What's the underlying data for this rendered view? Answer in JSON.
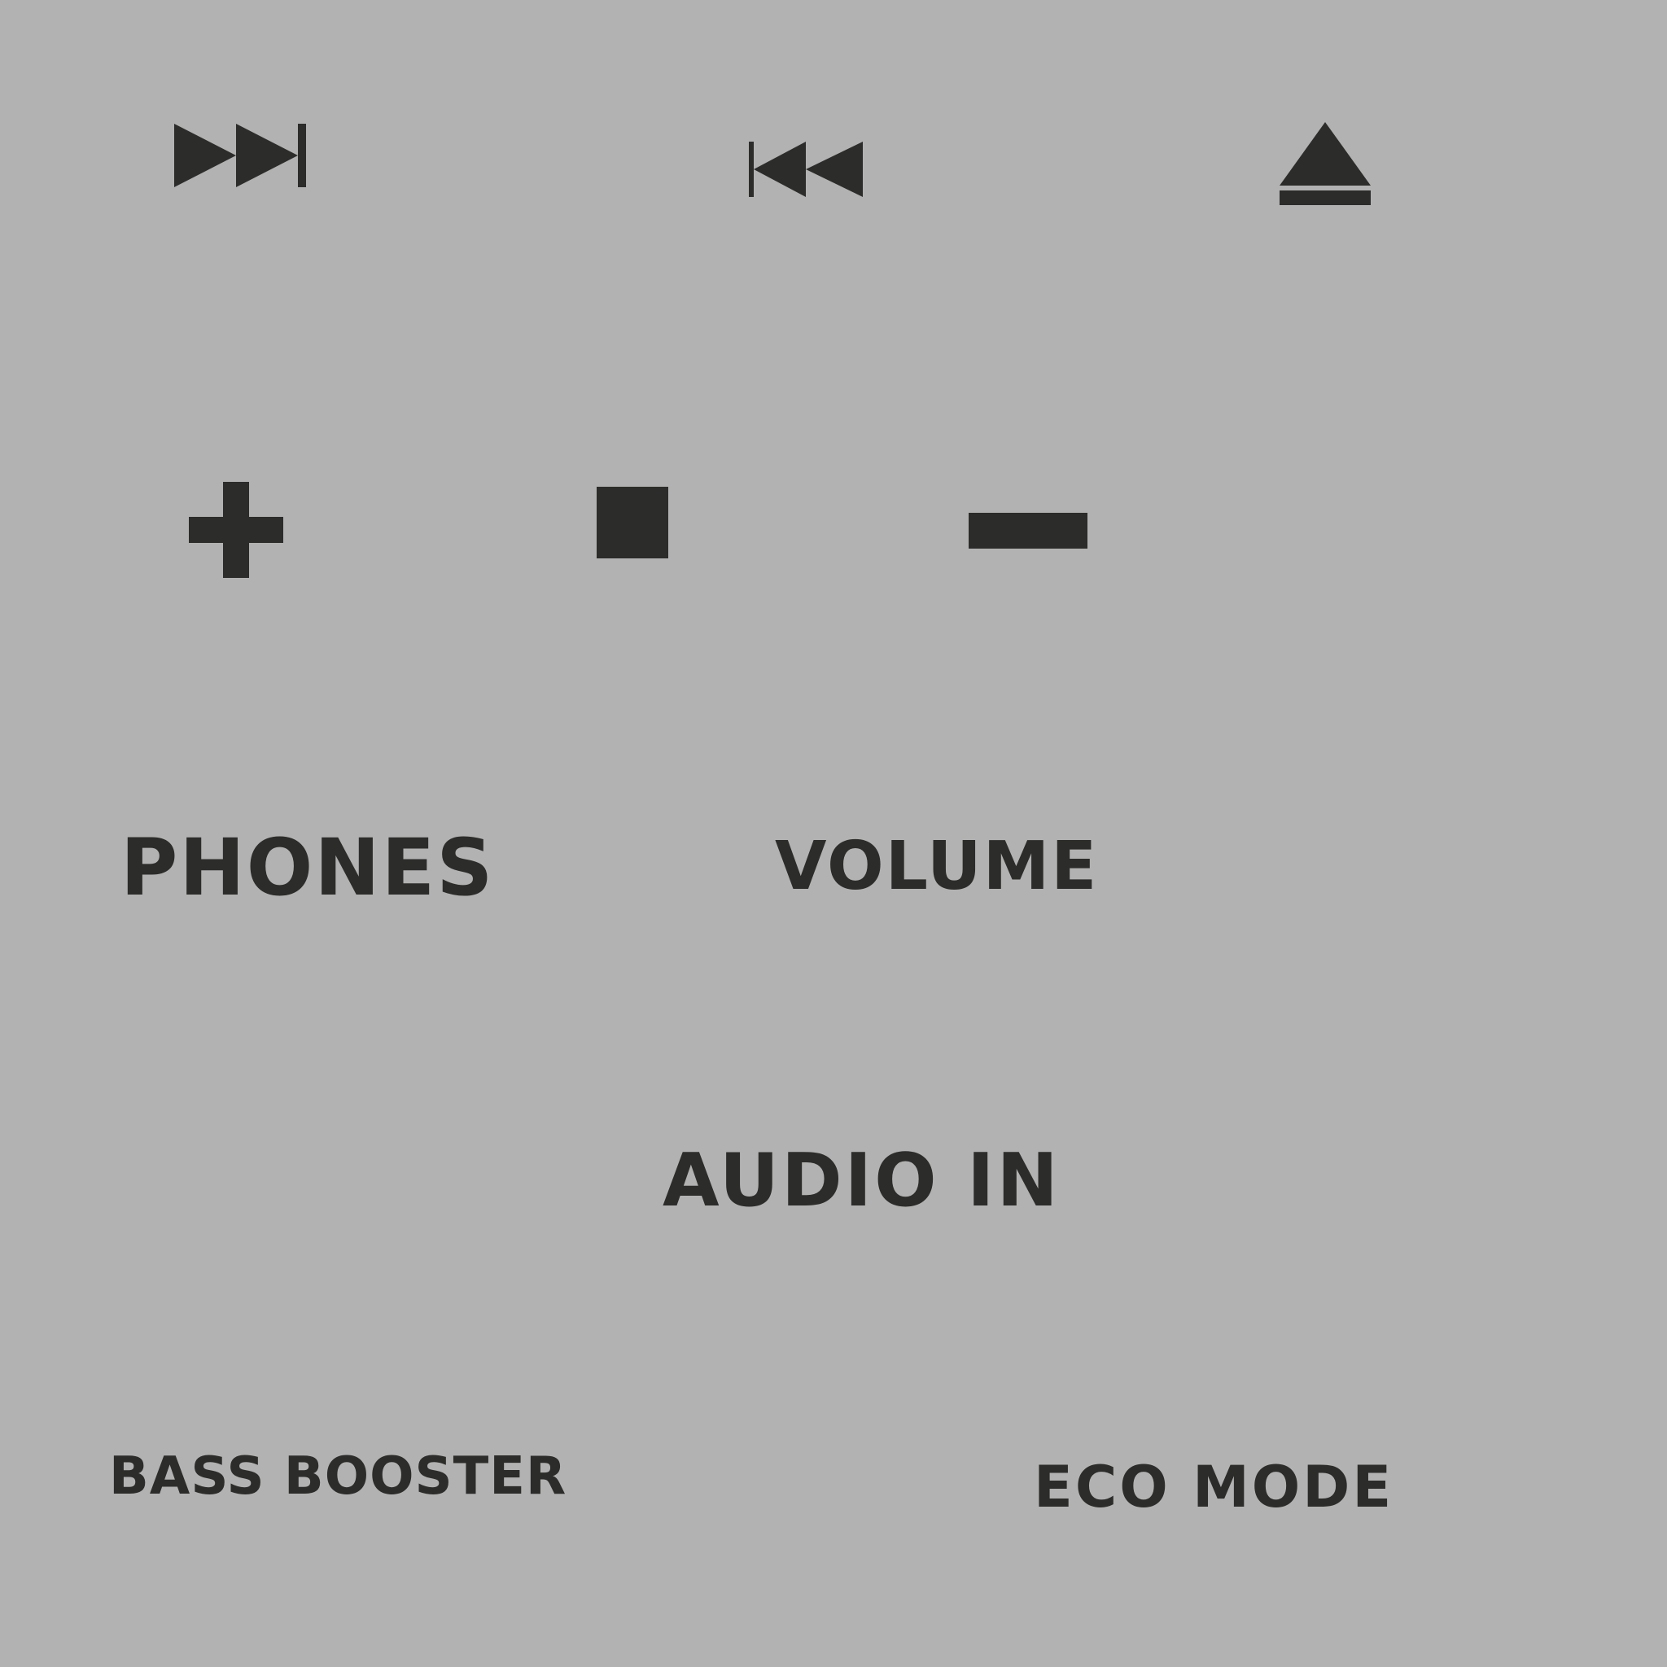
{
  "panel": {
    "background_color": "#b2b2b2",
    "ink_color": "#2c2c2a"
  },
  "buttons": {
    "next": {
      "icon": "skip-next-icon"
    },
    "previous": {
      "icon": "skip-previous-icon"
    },
    "eject": {
      "icon": "eject-icon"
    },
    "volume_up": {
      "icon": "plus-icon"
    },
    "stop": {
      "icon": "stop-icon"
    },
    "volume_down": {
      "icon": "minus-icon"
    }
  },
  "labels": {
    "phones": "PHONES",
    "volume": "VOLUME",
    "audio_in": "AUDIO IN",
    "bass_booster": "BASS BOOSTER",
    "eco_mode": "ECO MODE"
  }
}
